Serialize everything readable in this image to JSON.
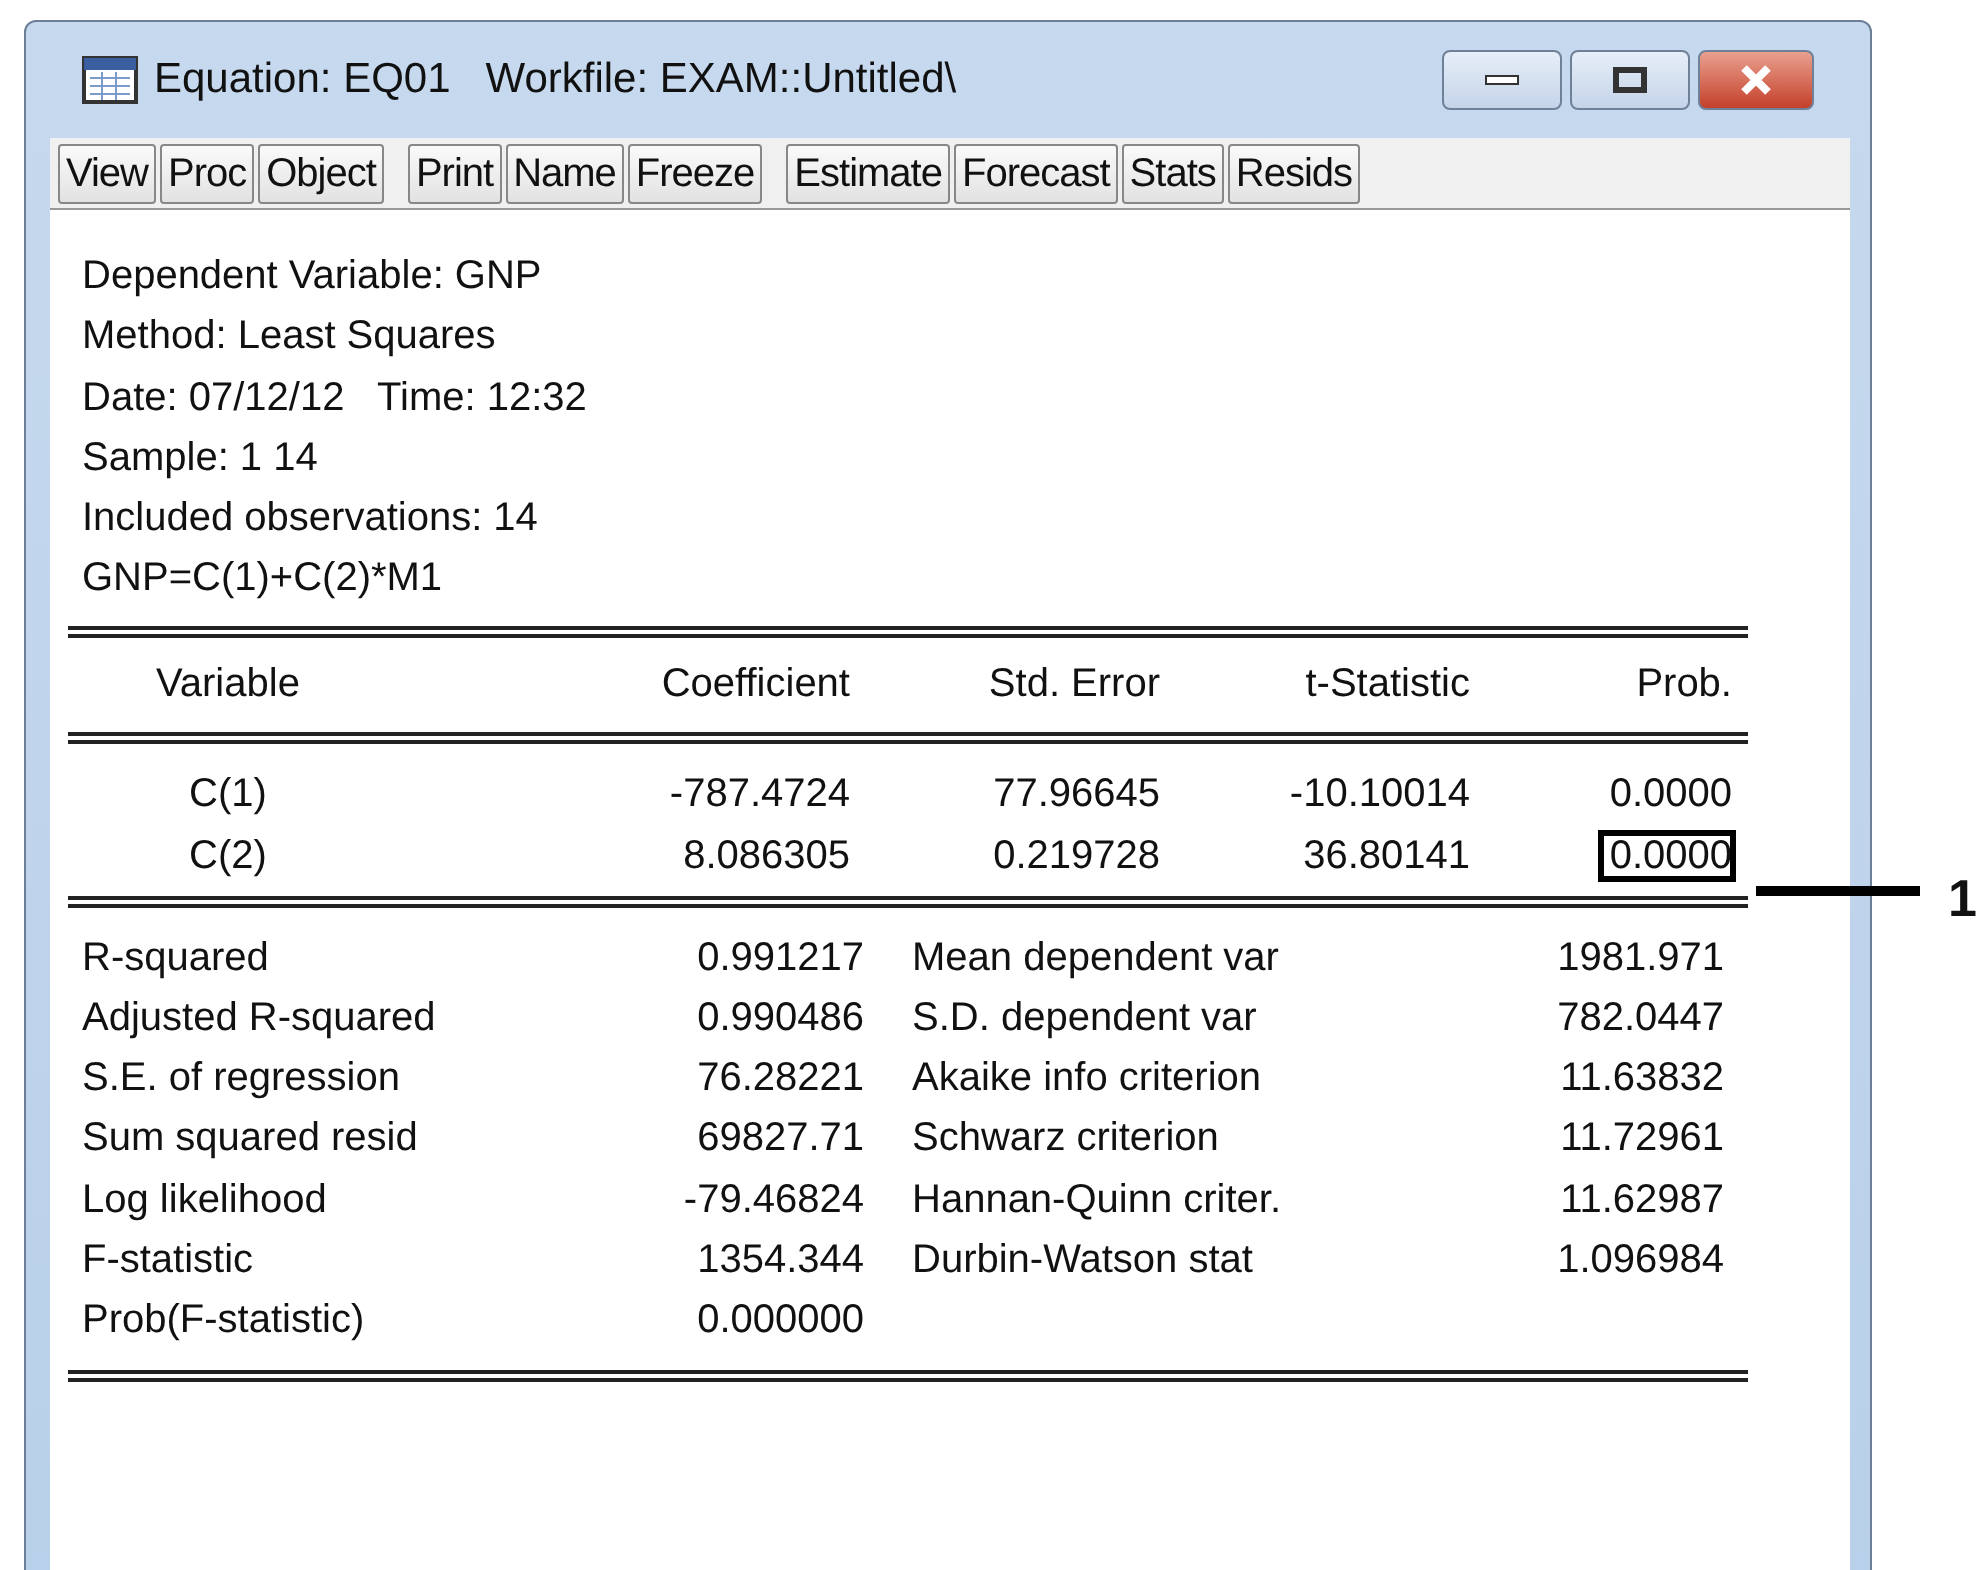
{
  "window": {
    "title": "Equation: EQ01   Workfile: EXAM::Untitled\\"
  },
  "toolbar_groups": [
    [
      "View",
      "Proc",
      "Object"
    ],
    [
      "Print",
      "Name",
      "Freeze"
    ],
    [
      "Estimate",
      "Forecast",
      "Stats",
      "Resids"
    ]
  ],
  "header_lines": [
    "Dependent Variable: GNP",
    "Method: Least Squares",
    "Date: 07/12/12   Time: 12:32",
    "Sample: 1 14",
    "Included observations: 14",
    "GNP=C(1)+C(2)*M1"
  ],
  "coefficients": {
    "columns": [
      "Variable",
      "Coefficient",
      "Std. Error",
      "t-Statistic",
      "Prob."
    ],
    "rows": [
      {
        "cells": [
          "C(1)",
          "-787.4724",
          "77.96645",
          "-10.10014",
          "0.0000"
        ],
        "prob_boxed": false
      },
      {
        "cells": [
          "C(2)",
          "8.086305",
          "0.219728",
          "36.80141",
          "0.0000"
        ],
        "prob_boxed": true
      }
    ]
  },
  "statistics": [
    {
      "label": "R-squared",
      "value": "0.991217",
      "label_2": "Mean dependent var",
      "value_2": "1981.971"
    },
    {
      "label": "Adjusted R-squared",
      "value": "0.990486",
      "label_2": "S.D. dependent var",
      "value_2": "782.0447"
    },
    {
      "label": "S.E. of regression",
      "value": "76.28221",
      "label_2": "Akaike info criterion",
      "value_2": "11.63832"
    },
    {
      "label": "Sum squared resid",
      "value": "69827.71",
      "label_2": "Schwarz criterion",
      "value_2": "11.72961"
    },
    {
      "label": "Log likelihood",
      "value": "-79.46824",
      "label_2": "Hannan-Quinn criter.",
      "value_2": "11.62987"
    },
    {
      "label": "F-statistic",
      "value": "1354.344",
      "label_2": "Durbin-Watson stat",
      "value_2": "1.096984"
    },
    {
      "label": "Prob(F-statistic)",
      "value": "0.000000"
    }
  ],
  "callout": {
    "label": "1"
  }
}
